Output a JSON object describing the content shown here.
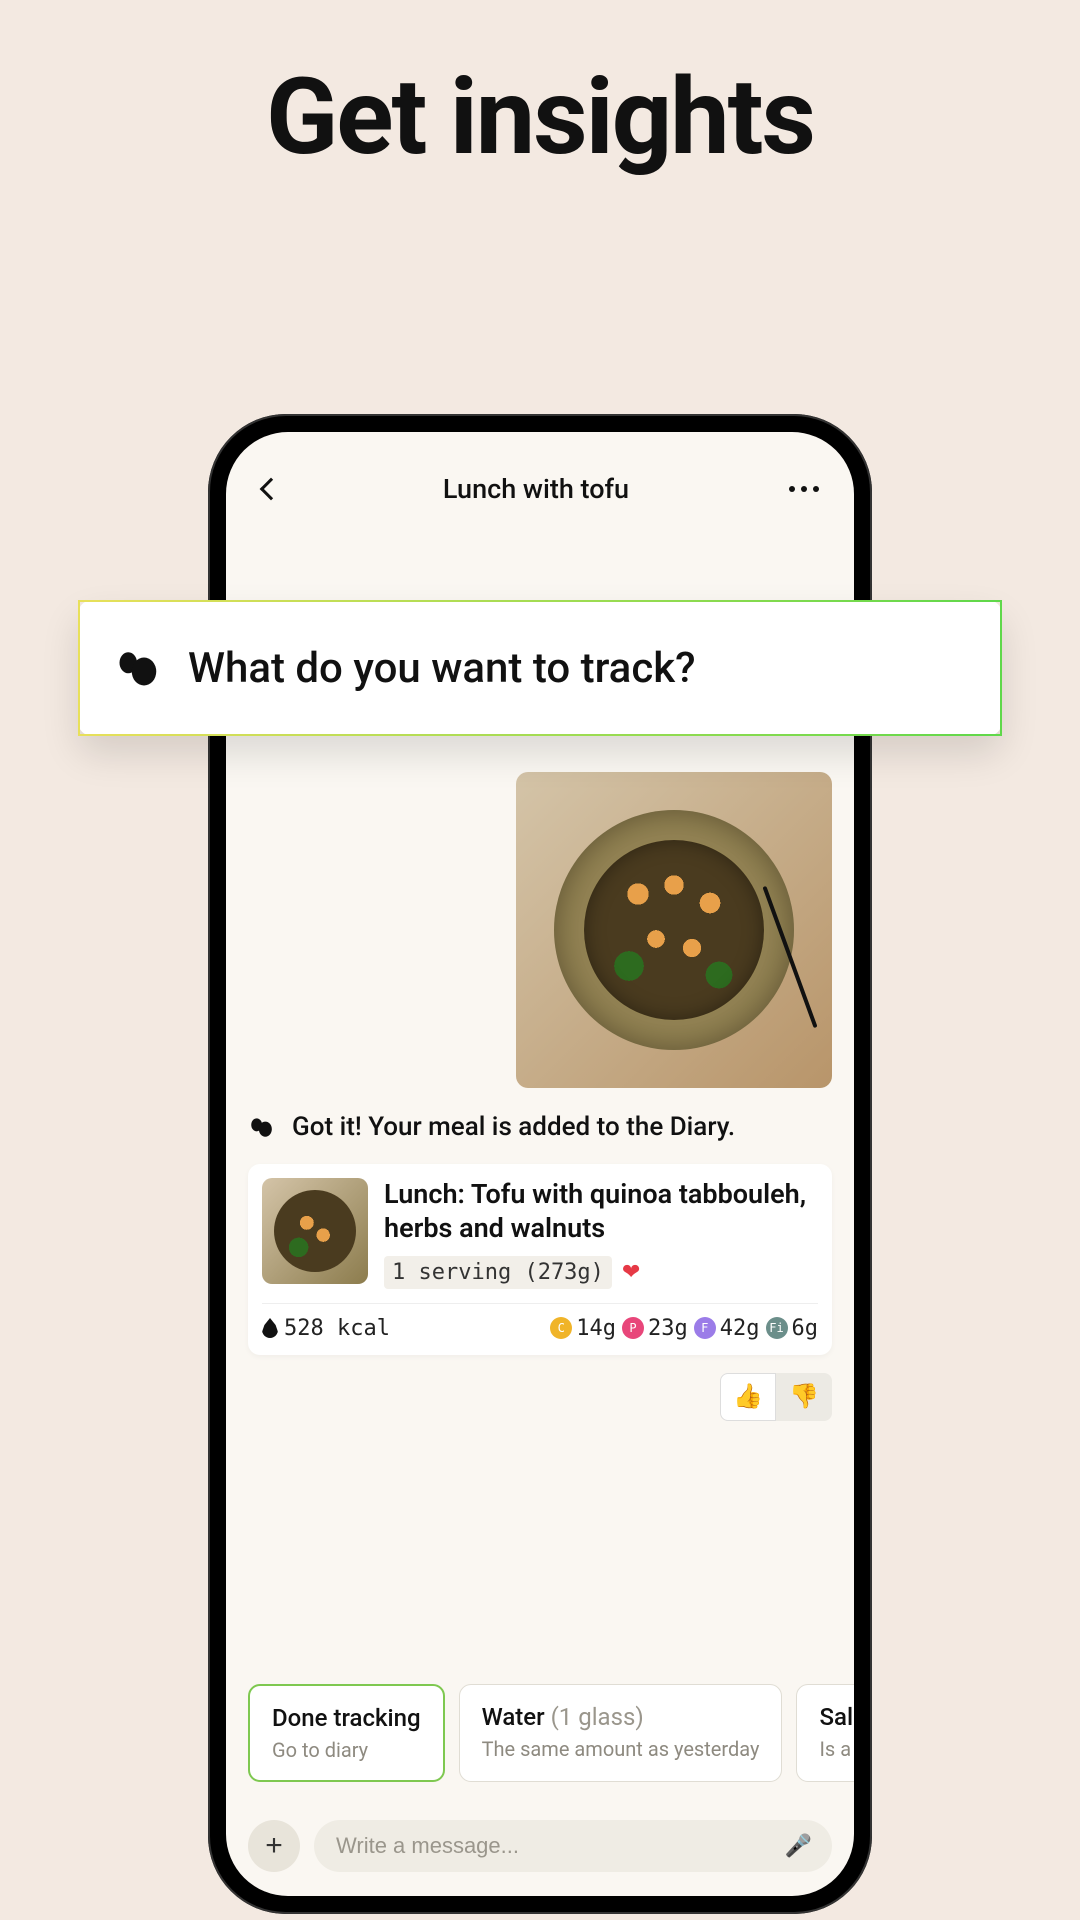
{
  "page_heading": "Get insights",
  "nav": {
    "title": "Lunch with tofu"
  },
  "overlay": {
    "prompt": "What do you want to track?"
  },
  "chat": {
    "bot_confirmation": "Got it! Your meal is added to the Diary."
  },
  "meal_card": {
    "title": "Lunch: Tofu with quinoa tabbouleh, herbs and walnuts",
    "serving": "1 serving (273g)",
    "calories": "528 kcal",
    "macros": {
      "carbs": "14g",
      "protein": "23g",
      "fat": "42g",
      "fiber": "6g"
    },
    "macro_labels": {
      "c": "C",
      "p": "P",
      "f": "F",
      "fi": "Fi"
    }
  },
  "suggestions": [
    {
      "title": "Done tracking",
      "detail": "",
      "subtitle": "Go to diary",
      "active": true
    },
    {
      "title": "Water",
      "detail": "(1 glass)",
      "subtitle": "The same amount as yesterday",
      "active": false
    },
    {
      "title": "Salm",
      "detail": "",
      "subtitle": "Is a co",
      "active": false
    }
  ],
  "composer": {
    "placeholder": "Write a message..."
  }
}
